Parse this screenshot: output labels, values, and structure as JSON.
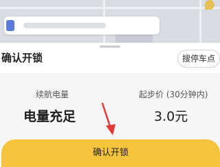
{
  "map": {
    "marker_color": "#e9b930"
  },
  "sheet": {
    "title": "确认开锁",
    "parking_button_label": "搜停车点"
  },
  "info": {
    "battery_label": "续航电量",
    "battery_value": "电量充足",
    "price_label": "起步价 (30分钟内)",
    "price_value": "3.0元"
  },
  "confirm_button": {
    "label": "确认开锁",
    "color": "#f6c33d"
  },
  "annotation": {
    "arrow_color": "#e53935"
  }
}
